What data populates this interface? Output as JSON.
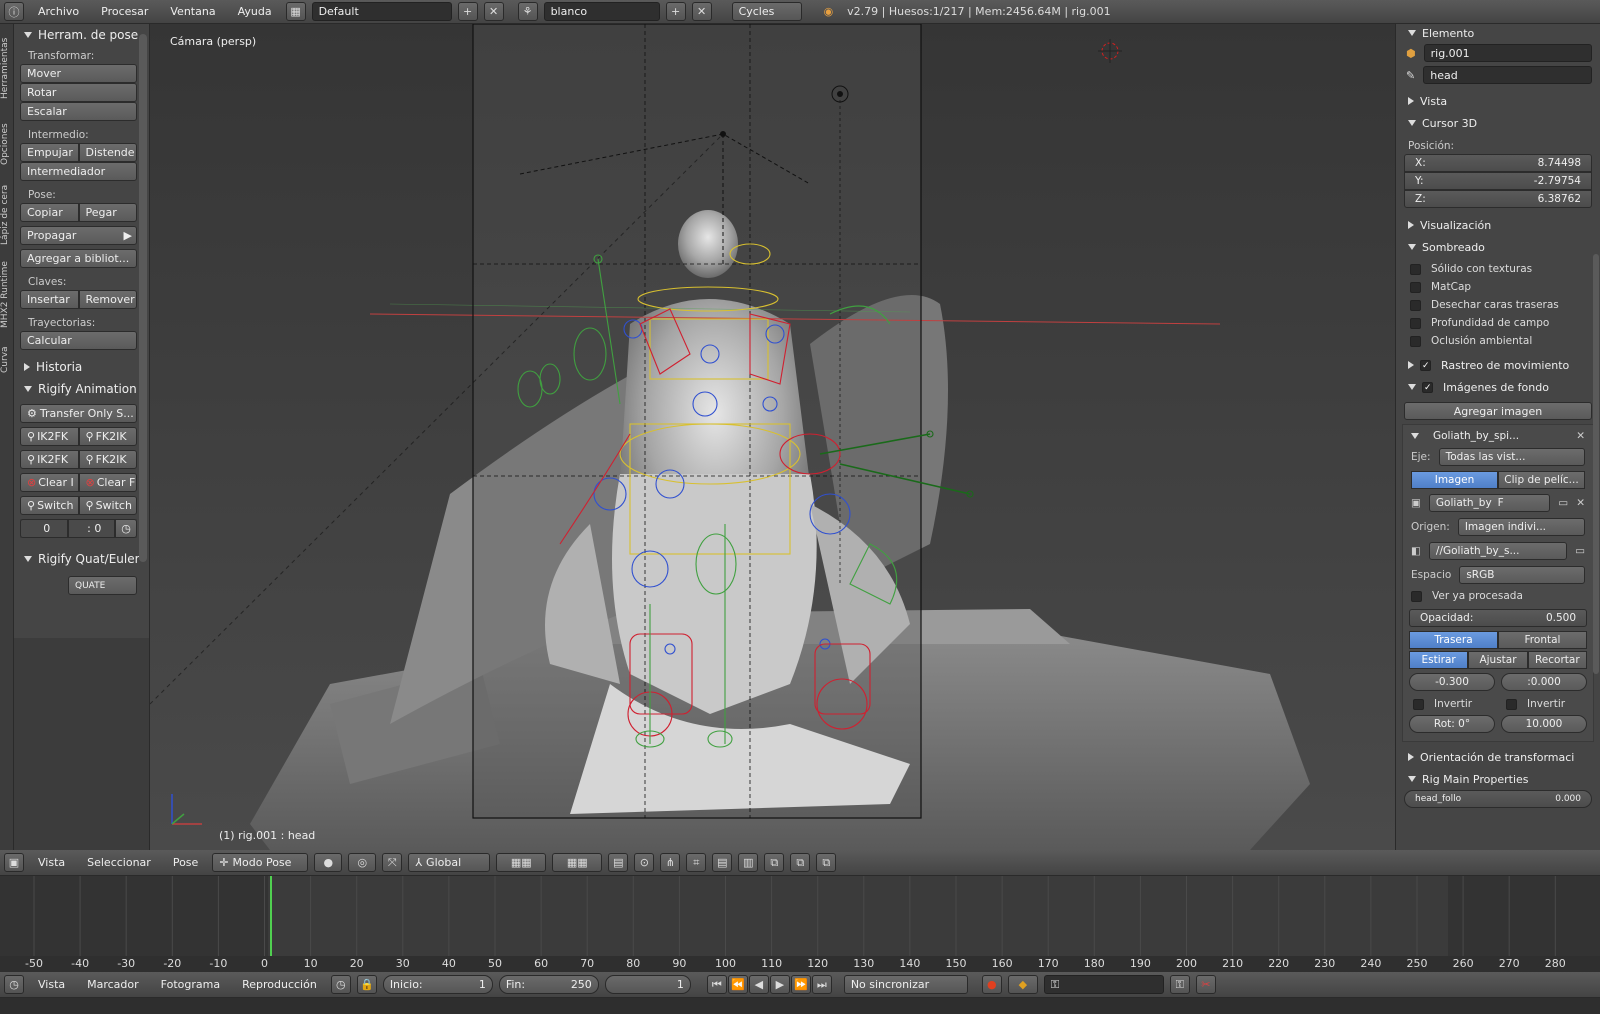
{
  "topbar": {
    "menus": [
      "Archivo",
      "Procesar",
      "Ventana",
      "Ayuda"
    ],
    "layout": "Default",
    "scene": "blanco",
    "engine": "Cycles",
    "info": "v2.79 | Huesos:1/217 | Mem:2456.64M | rig.001"
  },
  "lefttabs": [
    "Herramientas",
    "Opciones",
    "Lápiz de cera",
    "MHX2 Runtime",
    "Curva"
  ],
  "toolshelf": {
    "panel_title": "Herram. de pose",
    "transform_label": "Transformar:",
    "move": "Mover",
    "rotate": "Rotar",
    "scale": "Escalar",
    "inbetween_label": "Intermedio:",
    "push": "Empujar",
    "relax": "Distende",
    "breakdowner": "Intermediador",
    "pose_label": "Pose:",
    "copy": "Copiar",
    "paste": "Pegar",
    "propagate": "Propagar",
    "add_library": "Agregar a bibliot...",
    "keys_label": "Claves:",
    "insert": "Insertar",
    "remove": "Remover",
    "paths_label": "Trayectorias:",
    "calculate": "Calcular",
    "history": "Historia",
    "rigify_anim": "Rigify Animation",
    "transfer_only": "Transfer Only S...",
    "ik2fk_1": "IK2FK",
    "fk2ik_1": "FK2IK",
    "ik2fk_2": "IK2FK",
    "fk2ik_2": "FK2IK",
    "clear_1": "Clear I",
    "clear_2": "Clear F",
    "switch_1": "Switch",
    "switch_2": "Switch",
    "frame_a": "0",
    "frame_b": ": 0",
    "rigify_quat": "Rigify Quat/Euler",
    "quat_val": "QUATE"
  },
  "viewport": {
    "camera_label": "Cámara (persp)",
    "active_bone": "(1) rig.001 : head"
  },
  "props": {
    "item_panel": "Elemento",
    "object_name": "rig.001",
    "bone_name": "head",
    "view_panel": "Vista",
    "cursor_panel": "Cursor 3D",
    "position_label": "Posición:",
    "x_label": "X:",
    "x_val": "8.74498",
    "y_label": "Y:",
    "y_val": "-2.79754",
    "z_label": "Z:",
    "z_val": "6.38762",
    "display_panel": "Visualización",
    "shading_panel": "Sombreado",
    "shading_opts": [
      "Sólido con texturas",
      "MatCap",
      "Desechar caras traseras",
      "Profundidad de campo",
      "Oclusión ambiental"
    ],
    "motion_tracking": "Rastreo de movimiento",
    "bg_images": "Imágenes de fondo",
    "add_image": "Agregar imagen",
    "bg_item": "Goliath_by_spi...",
    "axis_label": "Eje:",
    "axis_val": "Todas las vist...",
    "image_tab": "Imagen",
    "clip_tab": "Clip de pelíc...",
    "img_name": "Goliath_by",
    "img_f": "F",
    "origin_label": "Origen:",
    "origin_val": "Imagen indivi...",
    "path_val": "//Goliath_by_s...",
    "space_label": "Espacio",
    "space_val": "sRGB",
    "view_processed": "Ver ya procesada",
    "opacity_label": "Opacidad:",
    "opacity_val": "0.500",
    "back": "Trasera",
    "front": "Frontal",
    "stretch": "Estirar",
    "fit": "Ajustar",
    "crop": "Recortar",
    "offx": "-0.300",
    "offy": ":0.000",
    "invert1": "Invertir",
    "invert2": "Invertir",
    "rot": "Rot: 0°",
    "size": "10.000",
    "transform_orient": "Orientación de transformaci",
    "rig_main": "Rig Main Properties",
    "last_prop": "head_follo",
    "last_val": "0.000"
  },
  "vpheader": {
    "view": "Vista",
    "select": "Seleccionar",
    "pose": "Pose",
    "mode": "Modo Pose",
    "orientation": "Global"
  },
  "timeline": {
    "ticks": [
      "-50",
      "-40",
      "-30",
      "-20",
      "-10",
      "0",
      "10",
      "20",
      "30",
      "40",
      "50",
      "60",
      "70",
      "80",
      "90",
      "100",
      "110",
      "120",
      "130",
      "140",
      "150",
      "160",
      "170",
      "180",
      "190",
      "200",
      "210",
      "220",
      "230",
      "240",
      "250",
      "260",
      "270",
      "280"
    ]
  },
  "tlheader": {
    "view": "Vista",
    "marker": "Marcador",
    "frame": "Fotograma",
    "playback": "Reproducción",
    "start_label": "Inicio:",
    "start_val": "1",
    "end_label": "Fin:",
    "end_val": "250",
    "current": "1",
    "sync": "No sincronizar"
  }
}
